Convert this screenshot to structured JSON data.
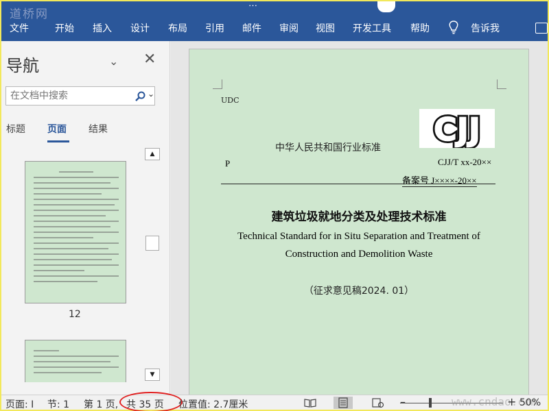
{
  "window": {
    "title_partial": "…",
    "watermark_top": "道桥网"
  },
  "menu": {
    "items": [
      "文件",
      "开始",
      "插入",
      "设计",
      "布局",
      "引用",
      "邮件",
      "审阅",
      "视图",
      "开发工具",
      "帮助"
    ],
    "tell_me": "告诉我"
  },
  "nav": {
    "title": "导航",
    "search_placeholder": "在文档中搜索",
    "tabs": [
      "标题",
      "页面",
      "结果"
    ],
    "active_tab": "页面",
    "thumb_page_number": "12"
  },
  "document": {
    "udc": "UDC",
    "standard_cn": "中华人民共和国行业标准",
    "p_letter": "P",
    "code": "CJJ/T xx-20××",
    "record": "备案号 J××××-20××",
    "title_cn": "建筑垃圾就地分类及处理技术标准",
    "title_en_line1": "Technical Standard for in Situ Separation and Treatment of",
    "title_en_line2": "Construction and Demolition Waste",
    "draft": "（征求意见稿2024. 01）",
    "logo_text": "CJJ"
  },
  "status": {
    "page": "页面: I",
    "section": "节: 1",
    "page_of_prefix": "第 1 页,",
    "page_total": "共 35 页",
    "position": "位置值: 2.7厘米",
    "zoom": "50%",
    "watermark_bottom": "www.cndao.com"
  },
  "colors": {
    "ribbon": "#2b579a",
    "page_bg": "#cfe7cf",
    "annotation_oval": "#e02020"
  }
}
